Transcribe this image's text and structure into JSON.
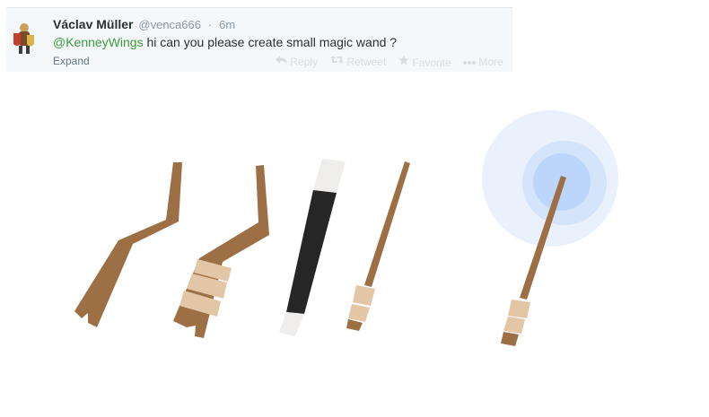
{
  "tweet": {
    "name": "Václav Müller",
    "handle": "@venca666",
    "separator": "·",
    "time": "6m",
    "mention": "@KenneyWings",
    "text": " hi can you please create small magic wand ?",
    "expand": "Expand",
    "actions": {
      "reply": "Reply",
      "retweet": "Retweet",
      "favorite": "Favorite",
      "more": "More"
    }
  },
  "colors": {
    "wood": "#9c6f45",
    "wrap": "#e3c6a6",
    "wand_black": "#262626",
    "wand_white": "#efeeed",
    "glow_outer": "#e8f1fc",
    "glow_mid": "#d4e4fb",
    "glow_inner": "#bcd6fb",
    "mention": "#3a9d3a"
  },
  "icons": [
    "avatar-knight-icon",
    "reply-icon",
    "retweet-icon",
    "favorite-icon",
    "more-icon"
  ]
}
